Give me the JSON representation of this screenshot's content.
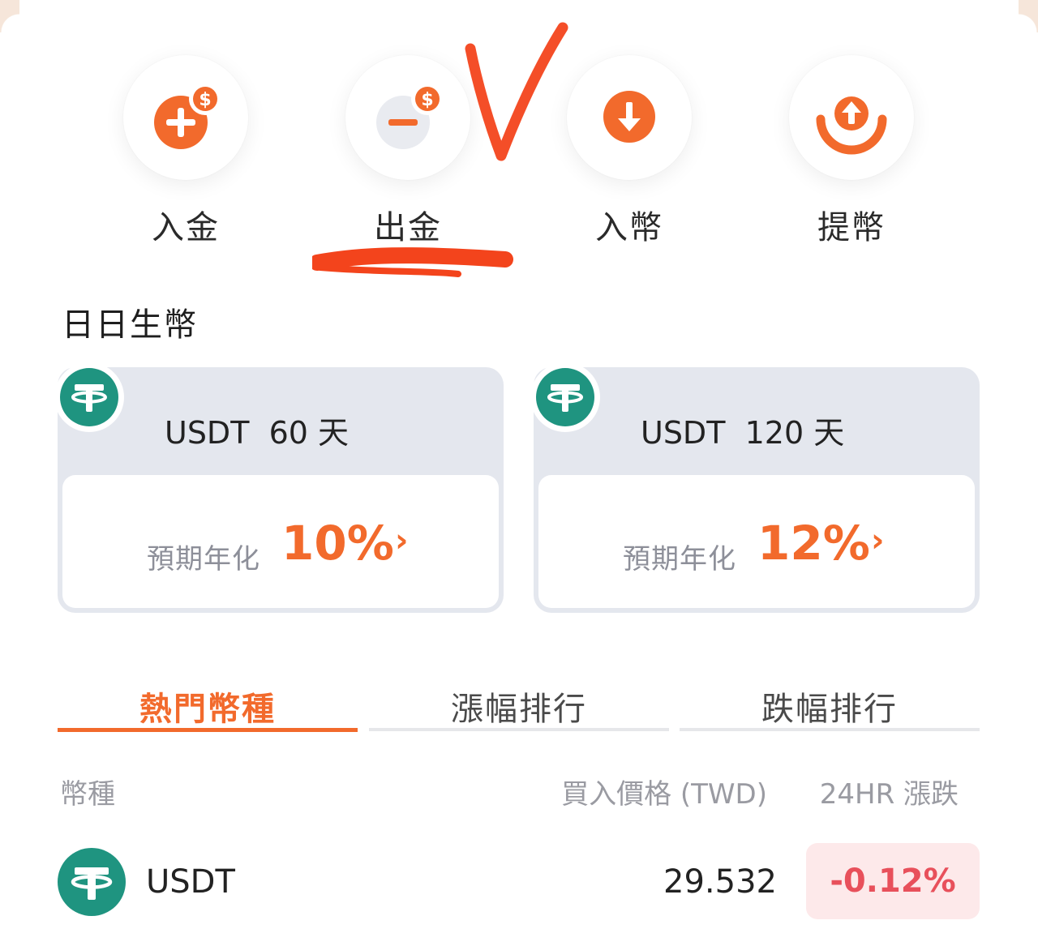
{
  "colors": {
    "accent": "#f26a2c",
    "tether_green": "#1f9480",
    "negative": "#e8505b",
    "negative_bg": "#fde9ea",
    "card_bg": "#e4e7ee",
    "annotation_red": "#f3441c"
  },
  "actions": [
    {
      "label": "入金",
      "icon": "deposit-plus-dollar-icon"
    },
    {
      "label": "出金",
      "icon": "withdraw-minus-dollar-icon"
    },
    {
      "label": "入幣",
      "icon": "coin-deposit-down-arrow-icon"
    },
    {
      "label": "提幣",
      "icon": "coin-withdraw-up-arrow-icon"
    }
  ],
  "annotations": {
    "check_mark": "handwritten-v-mark",
    "underline": "handwritten-underline"
  },
  "section_title": "日日生幣",
  "products": [
    {
      "coin": "USDT",
      "term": "60 天",
      "apy_label": "預期年化",
      "apy": "10%",
      "chevron": "›",
      "icon": "tether-icon"
    },
    {
      "coin": "USDT",
      "term": "120 天",
      "apy_label": "預期年化",
      "apy": "12%",
      "chevron": "›",
      "icon": "tether-icon"
    }
  ],
  "tabs": [
    {
      "label": "熱門幣種",
      "active": true
    },
    {
      "label": "漲幅排行",
      "active": false
    },
    {
      "label": "跌幅排行",
      "active": false
    }
  ],
  "table": {
    "headers": {
      "coin": "幣種",
      "price": "買入價格 (TWD)",
      "change": "24HR 漲跌"
    },
    "rows": [
      {
        "coin": "USDT",
        "price": "29.532",
        "change": "-0.12%",
        "icon": "tether-icon"
      }
    ]
  }
}
